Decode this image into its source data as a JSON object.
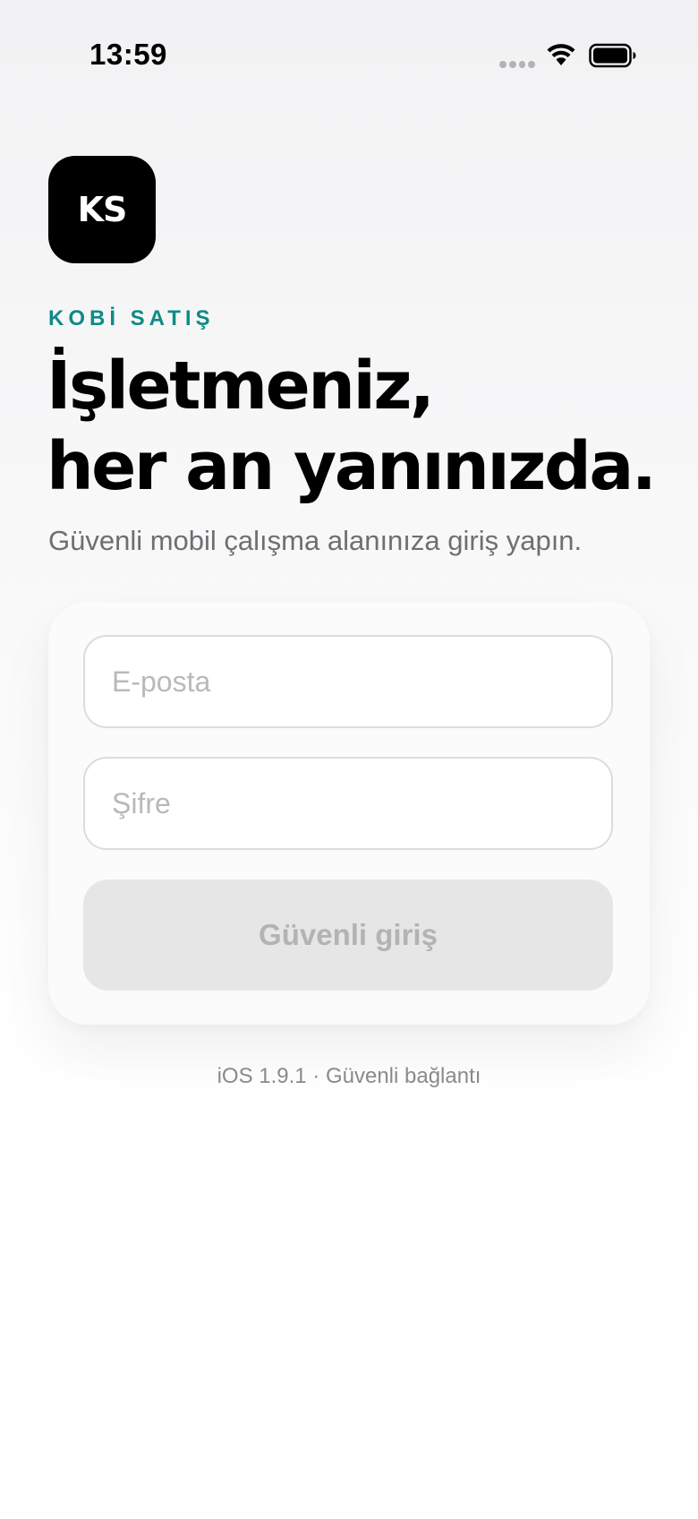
{
  "status_bar": {
    "time": "13:59",
    "icons": [
      "cellular-signal-icon",
      "wifi-icon",
      "battery-icon"
    ]
  },
  "brand": {
    "logo_text": "KS",
    "eyebrow": "KOBİ SATIŞ",
    "accent_color": "#0e8a86"
  },
  "hero": {
    "headline_line1": "İşletmeniz,",
    "headline_line2": "her an yanınızda.",
    "subtitle": "Güvenli mobil çalışma alanınıza giriş yapın."
  },
  "form": {
    "email_value": "",
    "email_placeholder": "E-posta",
    "password_value": "",
    "password_placeholder": "Şifre",
    "submit_label": "Güvenli giriş",
    "submit_enabled": false
  },
  "footer": {
    "version_text": "iOS 1.9.1 · Güvenli bağlantı"
  }
}
